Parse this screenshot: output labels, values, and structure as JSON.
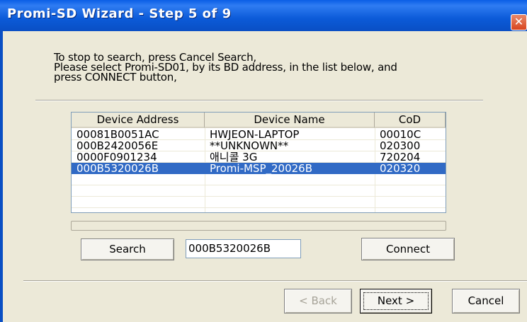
{
  "window": {
    "title": "Promi-SD Wizard - Step 5 of 9",
    "close_glyph": "✕",
    "close_icon": "close-icon"
  },
  "instructions": {
    "line1": "To stop to search, press Cancel Search,",
    "line2": "Please select Promi-SD01, by its BD address, in the list below, and",
    "line3": "press CONNECT button,"
  },
  "devices": {
    "columns": [
      "Device Address",
      "Device Name",
      "CoD"
    ],
    "rows": [
      [
        "00081B0051AC",
        "HWJEON-LAPTOP",
        "00010C"
      ],
      [
        "000B2420056E",
        "**UNKNOWN**",
        "020300"
      ],
      [
        "0000F0901234",
        "애니콜 3G",
        "720204"
      ],
      [
        "000B5320026B",
        "Promi-MSP_20026B",
        "020320"
      ]
    ],
    "selected_row": 3,
    "selection_color": "#316ac5"
  },
  "search_progress": 0,
  "controls": {
    "search_label": "Search",
    "address_value": "000B5320026B",
    "connect_label": "Connect"
  },
  "nav": {
    "back_label": "< Back",
    "next_label": "Next >",
    "cancel_label": "Cancel"
  },
  "colors": {
    "titlebar": "#0a5ee6",
    "dialog_bg": "#ece9d8"
  }
}
